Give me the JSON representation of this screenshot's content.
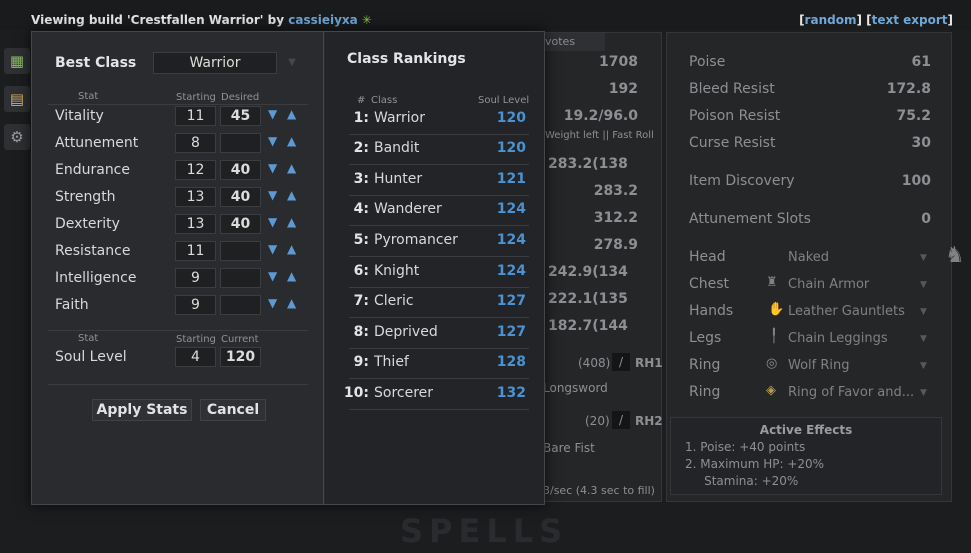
{
  "header": {
    "title_prefix": "Viewing build 'Crestfallen Warrior' by ",
    "author": "cassieiyxa",
    "leaf_icon": "✳",
    "links": [
      "random",
      "text export"
    ]
  },
  "background": {
    "votes_label": "votes",
    "mid_values": [
      "1708",
      "192",
      "19.2/96.0",
      "283.2(138",
      "283.2",
      "312.2",
      "278.9",
      "242.9(134",
      "222.1(135",
      "182.7(144"
    ],
    "weight_note": "Weight left || Fast Roll",
    "rh1": {
      "count": "(408)",
      "label": "RH1",
      "weapon": "Longsword"
    },
    "rh2": {
      "count": "(20)",
      "label": "RH2",
      "weapon": "Bare Fist"
    },
    "regen_note": "3/sec (4.3 sec to fill)",
    "ghost_text": "SPELLS"
  },
  "right_panel": {
    "stats": [
      {
        "label": "Poise",
        "value": "61"
      },
      {
        "label": "Bleed Resist",
        "value": "172.8"
      },
      {
        "label": "Poison Resist",
        "value": "75.2"
      },
      {
        "label": "Curse Resist",
        "value": "30"
      },
      {
        "label": "Item Discovery",
        "value": "100"
      },
      {
        "label": "Attunement Slots",
        "value": "0"
      }
    ],
    "equipment": [
      {
        "slot": "Head",
        "item": "Naked"
      },
      {
        "slot": "Chest",
        "item": "Chain Armor"
      },
      {
        "slot": "Hands",
        "item": "Leather Gauntlets"
      },
      {
        "slot": "Legs",
        "item": "Chain Leggings"
      },
      {
        "slot": "Ring",
        "item": "Wolf Ring"
      },
      {
        "slot": "Ring",
        "item": "Ring of Favor and..."
      }
    ],
    "effects": {
      "title": "Active Effects",
      "lines": [
        "1.  Poise: +40 points",
        "2.  Maximum HP: +20%",
        "     Stamina: +20%"
      ]
    }
  },
  "modal": {
    "best_class_label": "Best Class",
    "best_class_value": "Warrior",
    "col_stat": "Stat",
    "col_starting": "Starting",
    "col_desired": "Desired",
    "stats": [
      {
        "name": "Vitality",
        "starting": "11",
        "desired": "45"
      },
      {
        "name": "Attunement",
        "starting": "8",
        "desired": ""
      },
      {
        "name": "Endurance",
        "starting": "12",
        "desired": "40"
      },
      {
        "name": "Strength",
        "starting": "13",
        "desired": "40"
      },
      {
        "name": "Dexterity",
        "starting": "13",
        "desired": "40"
      },
      {
        "name": "Resistance",
        "starting": "11",
        "desired": ""
      },
      {
        "name": "Intelligence",
        "starting": "9",
        "desired": ""
      },
      {
        "name": "Faith",
        "starting": "9",
        "desired": ""
      }
    ],
    "soul_col_stat": "Stat",
    "soul_col_starting": "Starting",
    "soul_col_current": "Current",
    "soul_level": {
      "name": "Soul Level",
      "starting": "4",
      "current": "120"
    },
    "apply_label": "Apply Stats",
    "cancel_label": "Cancel",
    "rankings_title": "Class Rankings",
    "rank_col_num": "#",
    "rank_col_class": "Class",
    "rank_col_level": "Soul Level",
    "rankings": [
      {
        "num": "1:",
        "cls": "Warrior",
        "lvl": "120"
      },
      {
        "num": "2:",
        "cls": "Bandit",
        "lvl": "120"
      },
      {
        "num": "3:",
        "cls": "Hunter",
        "lvl": "121"
      },
      {
        "num": "4:",
        "cls": "Wanderer",
        "lvl": "124"
      },
      {
        "num": "5:",
        "cls": "Pyromancer",
        "lvl": "124"
      },
      {
        "num": "6:",
        "cls": "Knight",
        "lvl": "124"
      },
      {
        "num": "7:",
        "cls": "Cleric",
        "lvl": "127"
      },
      {
        "num": "8:",
        "cls": "Deprived",
        "lvl": "127"
      },
      {
        "num": "9:",
        "cls": "Thief",
        "lvl": "128"
      },
      {
        "num": "10:",
        "cls": "Sorcerer",
        "lvl": "132"
      }
    ]
  }
}
